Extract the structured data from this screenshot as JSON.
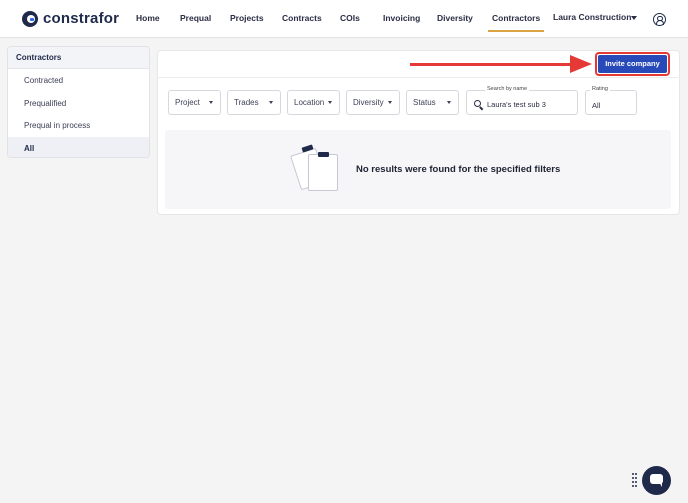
{
  "app": {
    "brand": "constrafor",
    "nav": [
      {
        "label": "Home"
      },
      {
        "label": "Prequal"
      },
      {
        "label": "Projects"
      },
      {
        "label": "Contracts"
      },
      {
        "label": "COIs"
      },
      {
        "label": "Invoicing"
      },
      {
        "label": "Diversity"
      },
      {
        "label": "Contractors",
        "active": true
      }
    ],
    "company": "Laura Construction",
    "icons": {
      "account": "account-circle-icon",
      "logo": "constrafor-logo-icon",
      "chat": "chat-icon",
      "grip": "grip-icon",
      "search": "search-icon",
      "empty": "clipboard-documents-icon"
    }
  },
  "sidebar": {
    "heading": "Contractors",
    "items": [
      {
        "label": "Contracted"
      },
      {
        "label": "Prequalified"
      },
      {
        "label": "Prequal in process"
      },
      {
        "label": "All",
        "active": true
      }
    ]
  },
  "toolbar": {
    "invite_label": "Invite company"
  },
  "filters": {
    "dropdowns": [
      {
        "label": "Project"
      },
      {
        "label": "Trades"
      },
      {
        "label": "Location"
      },
      {
        "label": "Diversity"
      },
      {
        "label": "Status"
      }
    ],
    "search": {
      "label": "Search by name",
      "value": "Laura's test sub 3"
    },
    "rating": {
      "label": "Rating",
      "value": "All"
    }
  },
  "results": {
    "empty_message": "No results were found for the specified filters"
  },
  "colors": {
    "primary": "#2849b8",
    "navy": "#1f2a4a",
    "annotation": "#e53935",
    "active_underline": "#d9a441"
  }
}
